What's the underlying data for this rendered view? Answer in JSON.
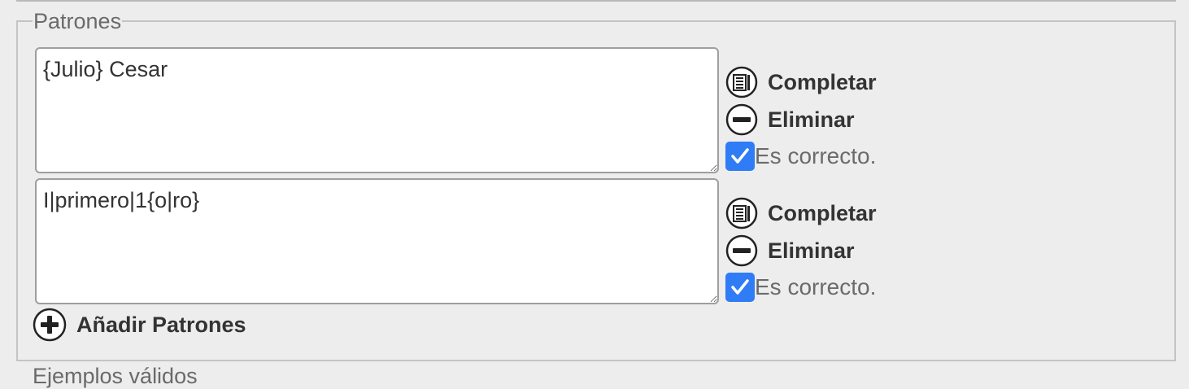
{
  "section": {
    "legend": "Patrones",
    "next_legend": "Ejemplos válidos"
  },
  "patterns": [
    {
      "value": "{Julio} Cesar",
      "complete_label": "Completar",
      "delete_label": "Eliminar",
      "correct_label": "Es correcto.",
      "correct_checked": true
    },
    {
      "value": "I|primero|1{o|ro}",
      "complete_label": "Completar",
      "delete_label": "Eliminar",
      "correct_label": "Es correcto.",
      "correct_checked": true
    }
  ],
  "add_label": "Añadir Patrones",
  "icons": {
    "complete": "document-list-icon",
    "delete": "minus-circle-icon",
    "add": "plus-circle-icon",
    "check": "checkmark-icon"
  },
  "colors": {
    "checkbox": "#2f7cf6",
    "background": "#ededed"
  }
}
